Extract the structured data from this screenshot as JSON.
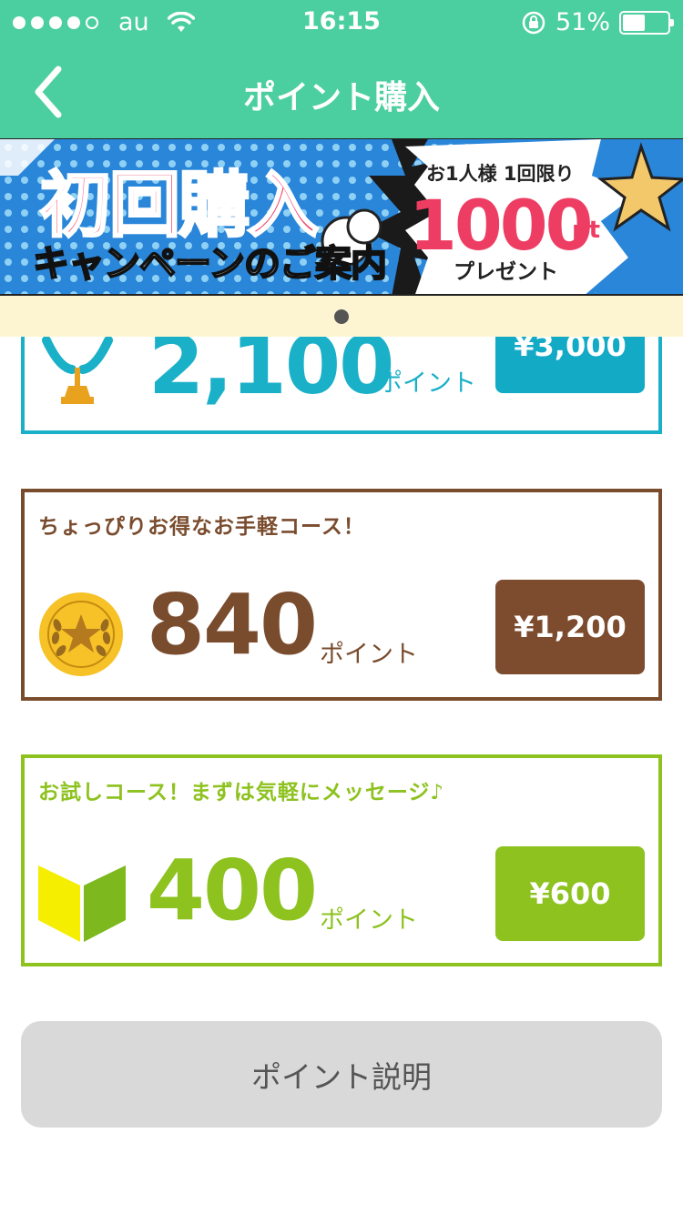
{
  "status_bar": {
    "carrier": "au",
    "time": "16:15",
    "battery_text": "51%",
    "battery_level": 0.51,
    "signal_dots_filled": 4,
    "signal_dots_total": 5
  },
  "nav": {
    "title": "ポイント購入",
    "back_icon": "chevron-left-icon"
  },
  "banner": {
    "title": "初回購入",
    "subtitle": "キャンペーンのご案内",
    "limit_text": "お1人様 1回限り",
    "points": "1000",
    "points_unit": "pt",
    "present_text": "プレゼント"
  },
  "pager": {
    "active_index": 0,
    "count": 1
  },
  "courses": [
    {
      "tagline": "",
      "points": "2,100",
      "unit": "ポイント",
      "price": "¥3,000",
      "icon": "trophy-icon",
      "color": "#1ab0c8"
    },
    {
      "tagline": "ちょっぴりお得なお手軽コース！",
      "points": "840",
      "unit": "ポイント",
      "price": "¥1,200",
      "icon": "gold-medal-icon",
      "color": "#7a4c2e"
    },
    {
      "tagline": "お試しコース！まずは気軽にメッセージ♪",
      "points": "400",
      "unit": "ポイント",
      "price": "¥600",
      "icon": "beginner-mark-icon",
      "color": "#8dc21f"
    }
  ],
  "explain_button": {
    "label": "ポイント説明"
  },
  "colors": {
    "header": "#4ccfa0",
    "pager_bg": "#fdf5d2",
    "button_gray": "#d9d9d9"
  }
}
